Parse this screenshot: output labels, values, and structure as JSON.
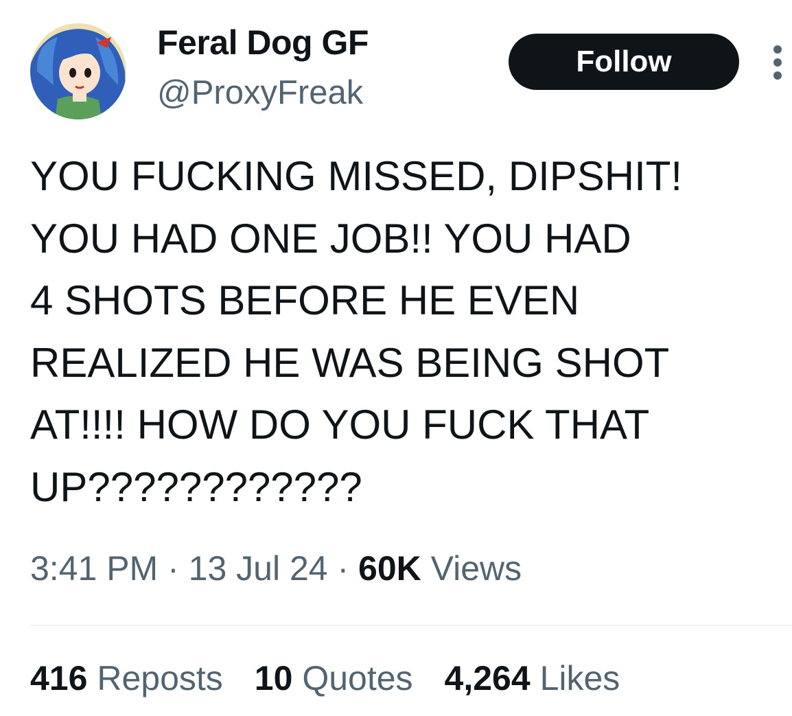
{
  "profile": {
    "display_name": "Feral Dog GF",
    "handle": "@ProxyFreak",
    "avatar_icon": "anime-girl-avatar"
  },
  "actions": {
    "follow_label": "Follow",
    "more_icon": "more-vertical-icon"
  },
  "tweet": {
    "lines": [
      "YOU FUCKING MISSED, DIPSHIT!",
      "YOU HAD ONE JOB!! YOU HAD",
      "4 SHOTS BEFORE HE EVEN",
      "REALIZED HE WAS BEING SHOT",
      "AT!!!! HOW DO YOU FUCK THAT",
      "UP????????????"
    ]
  },
  "meta": {
    "time": "3:41 PM",
    "separator": " · ",
    "date": "13 Jul 24",
    "views_count": "60K",
    "views_label": "Views"
  },
  "stats": {
    "reposts_count": "416",
    "reposts_label": "Reposts",
    "quotes_count": "10",
    "quotes_label": "Quotes",
    "likes_count": "4,264",
    "likes_label": "Likes"
  },
  "colors": {
    "text_primary": "#0f1419",
    "text_secondary": "#536471",
    "divider": "#eff3f4",
    "follow_bg": "#0f1419"
  }
}
